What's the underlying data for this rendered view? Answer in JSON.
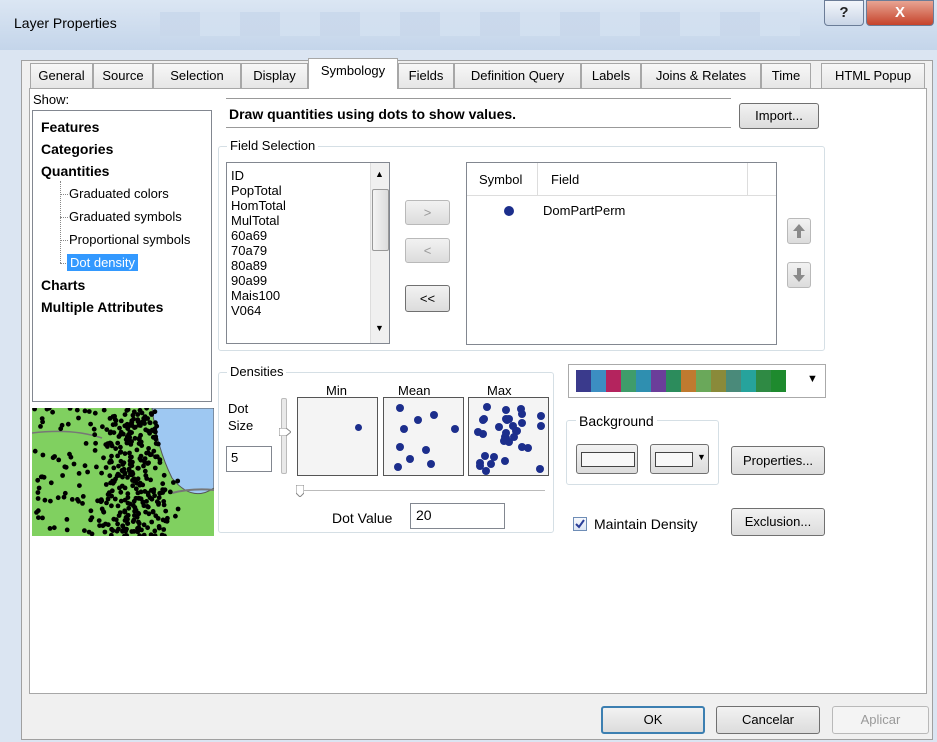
{
  "window": {
    "title": "Layer Properties",
    "help_glyph": "?",
    "close_glyph": "X"
  },
  "tabs": [
    {
      "label": "General"
    },
    {
      "label": "Source"
    },
    {
      "label": "Selection"
    },
    {
      "label": "Display"
    },
    {
      "label": "Symbology",
      "active": true
    },
    {
      "label": "Fields"
    },
    {
      "label": "Definition Query"
    },
    {
      "label": "Labels"
    },
    {
      "label": "Joins & Relates"
    },
    {
      "label": "Time"
    },
    {
      "label": "HTML Popup"
    }
  ],
  "show": {
    "label": "Show:",
    "items": {
      "features": "Features",
      "categories": "Categories",
      "quantities": "Quantities",
      "graduated_colors": "Graduated colors",
      "graduated_symbols": "Graduated symbols",
      "proportional_symbols": "Proportional symbols",
      "dot_density": "Dot density",
      "charts": "Charts",
      "multiple_attributes": "Multiple Attributes"
    },
    "selected": "Dot density"
  },
  "description": "Draw quantities using dots to show values.",
  "import_label": "Import...",
  "field_selection": {
    "label": "Field Selection",
    "fields": [
      "ID",
      "PopTotal",
      "HomTotal",
      "MulTotal",
      "60a69",
      "70a79",
      "80a89",
      "90a99",
      "Mais100",
      "V064"
    ],
    "add_label": ">",
    "remove_label": "<",
    "remove_all_label": "<<",
    "table_headers": {
      "symbol": "Symbol",
      "field": "Field"
    },
    "selected_fields": [
      {
        "field": "DomPartPerm",
        "color": "#1c2e8c"
      }
    ]
  },
  "densities": {
    "label": "Densities",
    "min_label": "Min",
    "mean_label": "Mean",
    "max_label": "Max",
    "dot_size_label": "Dot\nSize",
    "dot_size": "5",
    "dot_value_label": "Dot Value",
    "dot_value": "20"
  },
  "palette": [
    "#3a3a8c",
    "#3c8ec2",
    "#b4245e",
    "#3f9c6a",
    "#2f8fb0",
    "#6b3e9a",
    "#2c8c5c",
    "#bf7a2f",
    "#6aa85a",
    "#8a8a3a",
    "#4a8a7a",
    "#26a39c",
    "#2f8a44",
    "#1e8a2e"
  ],
  "background": {
    "label": "Background"
  },
  "properties_label": "Properties...",
  "maintain_density": {
    "label": "Maintain Density",
    "checked": true
  },
  "exclusion_label": "Exclusion...",
  "footer": {
    "ok": "OK",
    "cancel": "Cancelar",
    "apply": "Aplicar"
  },
  "colors": {
    "dot": "#1c2e8c",
    "selection": "#3399ff",
    "map_green": "#80d060",
    "map_water": "#9ec8f2"
  }
}
